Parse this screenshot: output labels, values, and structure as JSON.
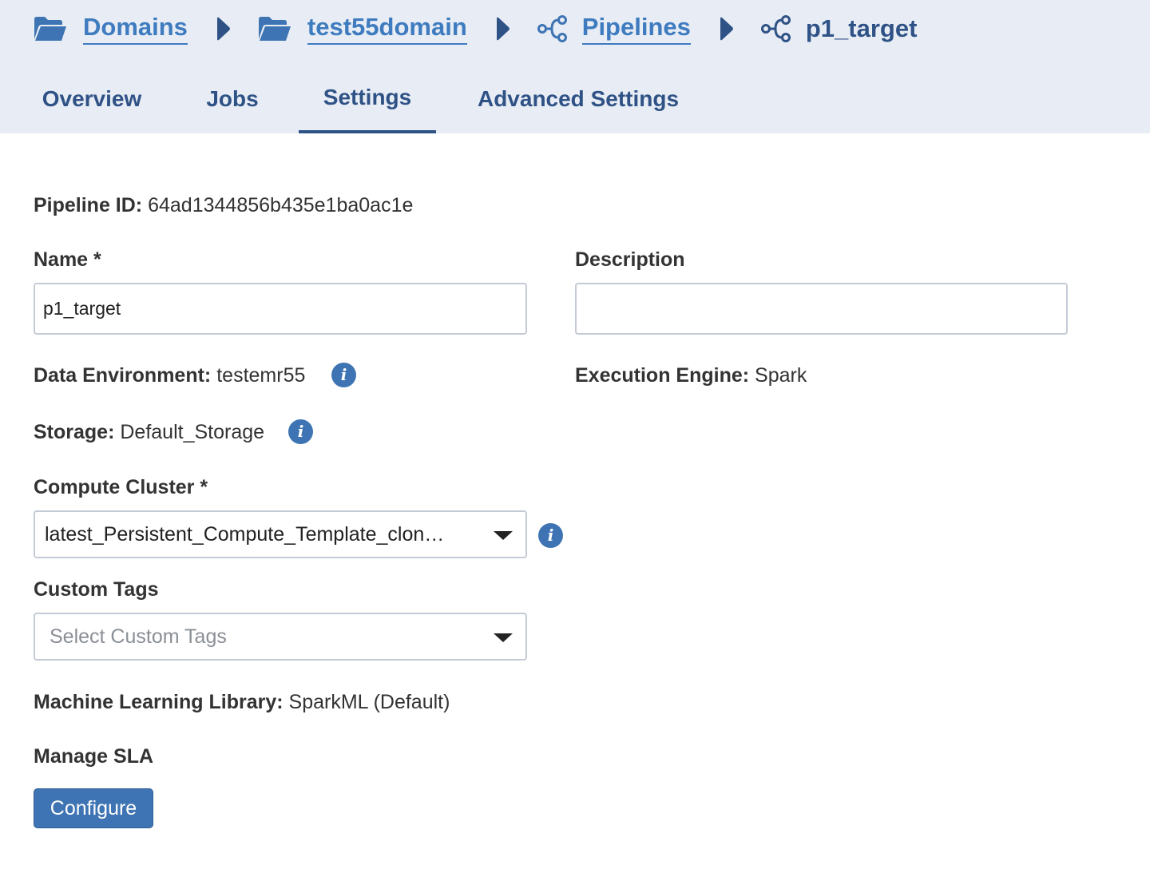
{
  "breadcrumb": {
    "domains": "Domains",
    "domain": "test55domain",
    "pipelines": "Pipelines",
    "current": "p1_target"
  },
  "tabs": [
    {
      "label": "Overview"
    },
    {
      "label": "Jobs"
    },
    {
      "label": "Settings",
      "active": true
    },
    {
      "label": "Advanced Settings"
    }
  ],
  "settings": {
    "pipeline_id_label": "Pipeline ID:",
    "pipeline_id": "64ad1344856b435e1ba0ac1e",
    "name_label": "Name *",
    "name_value": "p1_target",
    "description_label": "Description",
    "description_value": "",
    "data_env_label": "Data Environment:",
    "data_env_value": "testemr55",
    "exec_engine_label": "Execution Engine:",
    "exec_engine_value": "Spark",
    "storage_label": "Storage:",
    "storage_value": "Default_Storage",
    "compute_cluster_label": "Compute Cluster *",
    "compute_cluster_value": "latest_Persistent_Compute_Template_clon…",
    "custom_tags_label": "Custom Tags",
    "custom_tags_placeholder": "Select Custom Tags",
    "ml_library_label": "Machine Learning Library:",
    "ml_library_value": "SparkML (Default)",
    "manage_sla_label": "Manage SLA",
    "configure_button": "Configure"
  },
  "colors": {
    "header_bg": "#e8edf5",
    "link": "#3e7bbf",
    "nav_text": "#2f5286",
    "primary_button": "#3e74b3"
  },
  "icons": {
    "folder": "folder-icon",
    "separator": "caret-right-icon",
    "pipeline": "pipeline-icon",
    "info": "info-icon",
    "dropdown": "chevron-down-icon"
  }
}
